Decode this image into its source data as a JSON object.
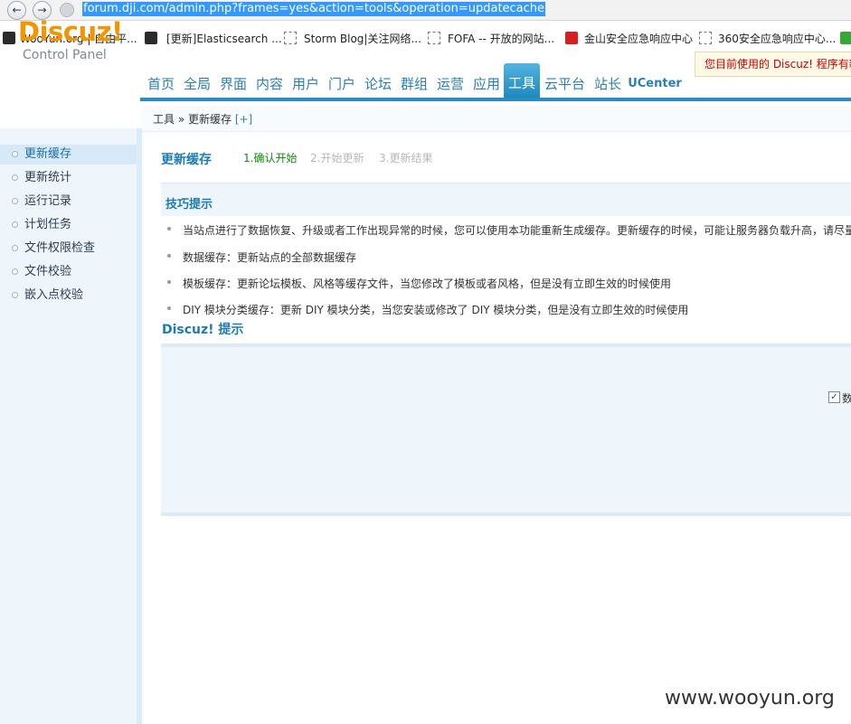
{
  "browser": {
    "url": "forum.dji.com/admin.php?frames=yes&action=tools&operation=updatecache",
    "back_icon": "back-arrow-icon",
    "forward_icon": "forward-arrow-icon",
    "bookmarks": [
      {
        "label": "WooYun.org | 自由平...",
        "icon": "wooyun-icon"
      },
      {
        "label": "[更新]Elasticsearch ...",
        "icon": "wooyun-icon"
      },
      {
        "label": "Storm Blog|关注网络...",
        "icon": "blank-page-icon"
      },
      {
        "label": "FOFA -- 开放的网站...",
        "icon": "blank-page-icon"
      },
      {
        "label": "金山安全应急响应中心",
        "icon": "kingsoft-icon"
      },
      {
        "label": "360安全应急响应中心...",
        "icon": "blank-page-icon"
      }
    ]
  },
  "header": {
    "logo": "Discuz!",
    "logo_sub": "Control Panel",
    "notice": "您目前使用的 Discuz! 程序有新"
  },
  "topnav": {
    "items": [
      "首页",
      "全局",
      "界面",
      "内容",
      "用户",
      "门户",
      "论坛",
      "群组",
      "运营",
      "应用",
      "工具",
      "云平台",
      "站长",
      "UCenter"
    ],
    "active": "工具"
  },
  "breadcrumb": {
    "path": "工具 » 更新缓存",
    "add": "[+]"
  },
  "sidebar": {
    "items": [
      "更新缓存",
      "更新统计",
      "运行记录",
      "计划任务",
      "文件权限检查",
      "文件校验",
      "嵌入点校验"
    ],
    "active": "更新缓存"
  },
  "main": {
    "title": "更新缓存",
    "steps": [
      "1.确认开始",
      "2.开始更新",
      "3.更新结果"
    ],
    "tips_title": "技巧提示",
    "tips": [
      "当站点进行了数据恢复、升级或者工作出现异常的时候，您可以使用本功能重新生成缓存。更新缓存的时候，可能让服务器负载升高，请尽量",
      "数据缓存：更新站点的全部数据缓存",
      "模板缓存：更新论坛模板、风格等缓存文件，当您修改了模板或者风格，但是没有立即生效的时候使用",
      "DIY 模块分类缓存：更新 DIY 模块分类，当您安装或修改了 DIY 模块分类，但是没有立即生效的时候使用"
    ],
    "hint_title": "Discuz! 提示",
    "hint_checkbox_label": "数",
    "hint_checkbox_checked": true
  },
  "watermark": "www.wooyun.org"
}
